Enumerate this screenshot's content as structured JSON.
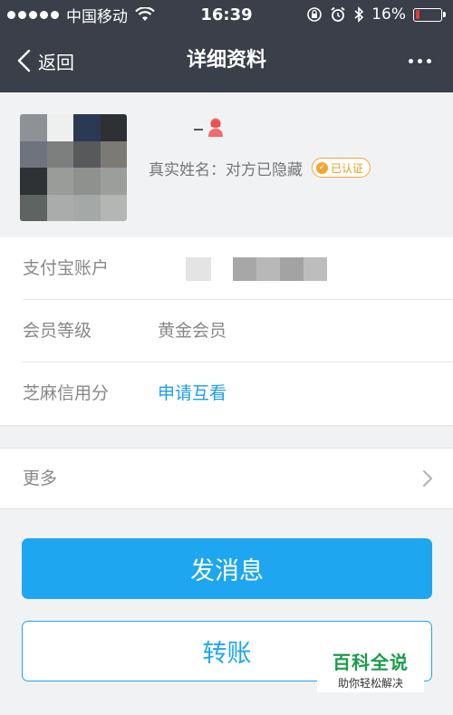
{
  "status_bar": {
    "carrier": "中国移动",
    "time": "16:39",
    "battery_percent": "16%",
    "battery_level": 0.16,
    "battery_color": "#e53935",
    "icons": [
      "signal-dots",
      "wifi-icon",
      "rotation-lock-icon",
      "alarm-icon",
      "bluetooth-icon",
      "battery-icon"
    ]
  },
  "nav": {
    "back_label": "返回",
    "title": "详细资料",
    "more_icon": "more-dots-icon"
  },
  "profile": {
    "realname_label": "真实姓名：",
    "realname_value": "对方已隐藏",
    "verified_label": "已认证",
    "gender_icon": "female-user-icon",
    "avatar_colors": [
      "#8e9297",
      "#eef0ef",
      "#2b3a52",
      "#2d3134",
      "#6e737d",
      "#7d7f7e",
      "#57595b",
      "#7b7a74",
      "#2e3234",
      "#9a9c99",
      "#8f918f",
      "#9c9e9b",
      "#5d6462",
      "#a9acaa",
      "#a4a8a6",
      "#b3b6b3"
    ]
  },
  "info": {
    "rows": [
      {
        "label": "支付宝账户",
        "value": ""
      },
      {
        "label": "会员等级",
        "value": "黄金会员"
      },
      {
        "label": "芝麻信用分",
        "value": "申请互看"
      }
    ],
    "account_blur_colors": [
      "#a7a7a7",
      "#b8b8b8",
      "#a3a3a3",
      "#bdbdbd"
    ]
  },
  "more": {
    "label": "更多",
    "icon": "chevron-right-icon"
  },
  "actions": {
    "send_message": "发消息",
    "transfer": "转账"
  },
  "watermark": {
    "title": "百科全说",
    "subtitle": "助你轻松解决"
  },
  "colors": {
    "nav_bg": "#3a3f49",
    "accent": "#1ea6f0",
    "badge": "#f0a637"
  }
}
